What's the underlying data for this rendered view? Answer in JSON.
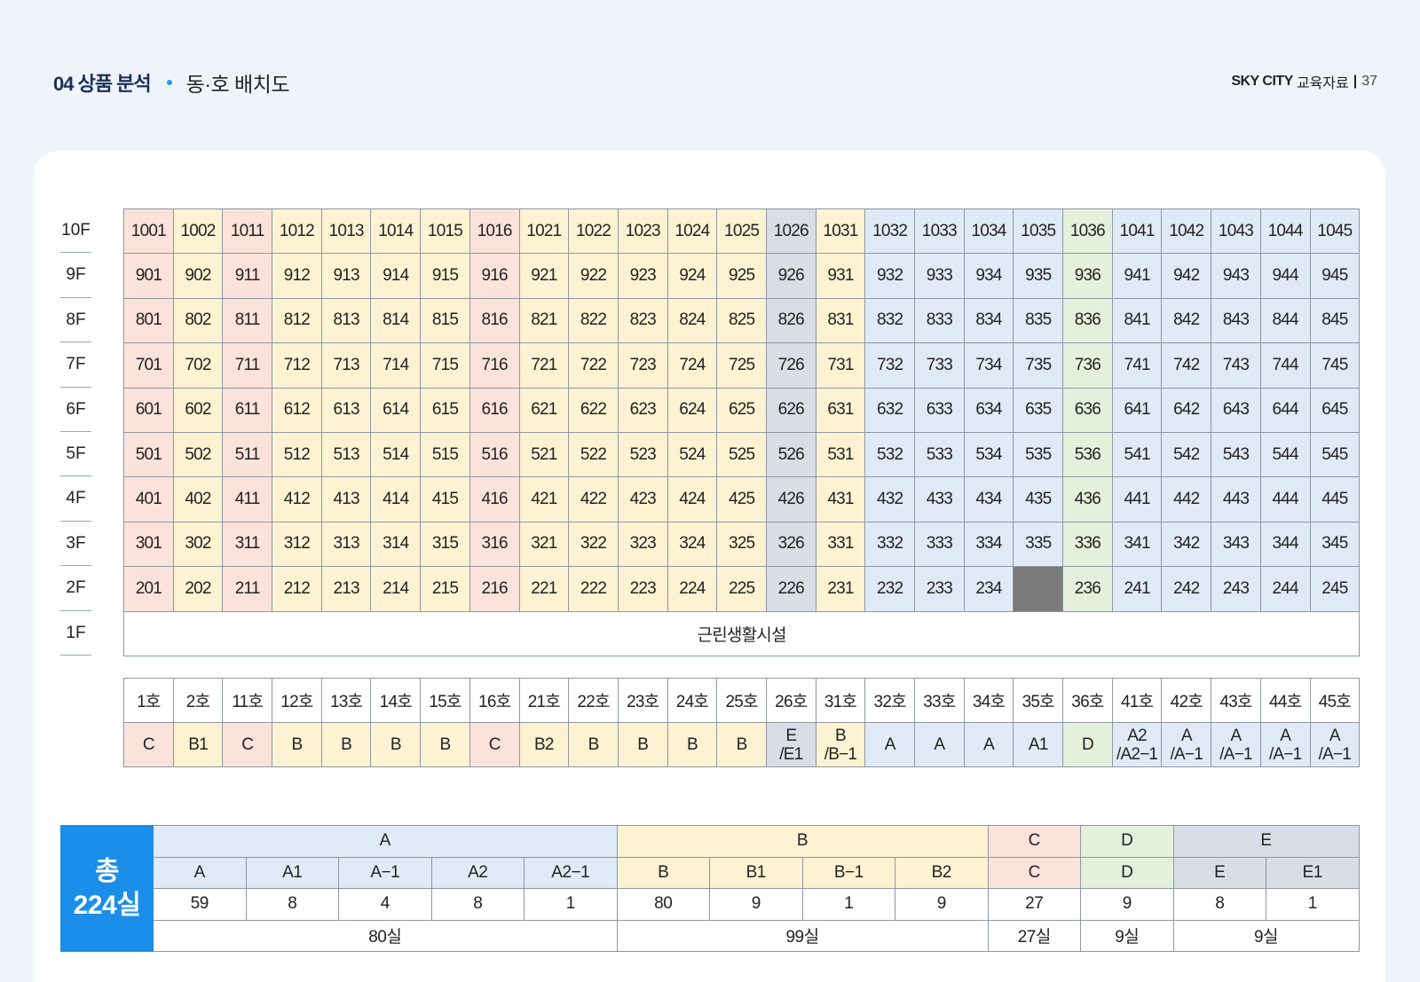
{
  "header": {
    "section": "04 상품 분석",
    "subtitle": "동·호 배치도",
    "brand": "SKY CITY",
    "doc": "교육자료",
    "page": "37"
  },
  "floors": [
    "10F",
    "9F",
    "8F",
    "7F",
    "6F",
    "5F",
    "4F",
    "3F",
    "2F",
    "1F"
  ],
  "units": [
    {
      "ho": "1호",
      "type": "C",
      "cls": "C"
    },
    {
      "ho": "2호",
      "type": "B1",
      "cls": "B"
    },
    {
      "ho": "11호",
      "type": "C",
      "cls": "C"
    },
    {
      "ho": "12호",
      "type": "B",
      "cls": "B"
    },
    {
      "ho": "13호",
      "type": "B",
      "cls": "B"
    },
    {
      "ho": "14호",
      "type": "B",
      "cls": "B"
    },
    {
      "ho": "15호",
      "type": "B",
      "cls": "B"
    },
    {
      "ho": "16호",
      "type": "C",
      "cls": "C"
    },
    {
      "ho": "21호",
      "type": "B2",
      "cls": "B"
    },
    {
      "ho": "22호",
      "type": "B",
      "cls": "B"
    },
    {
      "ho": "23호",
      "type": "B",
      "cls": "B"
    },
    {
      "ho": "24호",
      "type": "B",
      "cls": "B"
    },
    {
      "ho": "25호",
      "type": "B",
      "cls": "B"
    },
    {
      "ho": "26호",
      "type": "E\n/E1",
      "cls": "E"
    },
    {
      "ho": "31호",
      "type": "B\n/B−1",
      "cls": "B"
    },
    {
      "ho": "32호",
      "type": "A",
      "cls": "A"
    },
    {
      "ho": "33호",
      "type": "A",
      "cls": "A"
    },
    {
      "ho": "34호",
      "type": "A",
      "cls": "A"
    },
    {
      "ho": "35호",
      "type": "A1",
      "cls": "A"
    },
    {
      "ho": "36호",
      "type": "D",
      "cls": "D"
    },
    {
      "ho": "41호",
      "type": "A2\n/A2−1",
      "cls": "A"
    },
    {
      "ho": "42호",
      "type": "A\n/A−1",
      "cls": "A"
    },
    {
      "ho": "43호",
      "type": "A\n/A−1",
      "cls": "A"
    },
    {
      "ho": "44호",
      "type": "A\n/A−1",
      "cls": "A"
    },
    {
      "ho": "45호",
      "type": "A\n/A−1",
      "cls": "A"
    }
  ],
  "unit_numbers": [
    "01",
    "02",
    "11",
    "12",
    "13",
    "14",
    "15",
    "16",
    "21",
    "22",
    "23",
    "24",
    "25",
    "26",
    "31",
    "32",
    "33",
    "34",
    "35",
    "36",
    "41",
    "42",
    "43",
    "44",
    "45"
  ],
  "upper_floors": [
    10,
    9,
    8,
    7,
    6,
    5,
    4,
    3,
    2
  ],
  "empty_cells": [
    {
      "floor": 2,
      "unit": "35"
    }
  ],
  "first_floor_label": "근린생활시설",
  "summary": {
    "total_label_1": "총",
    "total_label_2": "224실",
    "groups": [
      {
        "name": "A",
        "cls": "A",
        "types": [
          "A",
          "A1",
          "A−1",
          "A2",
          "A2−1"
        ],
        "counts": [
          "59",
          "8",
          "4",
          "8",
          "1"
        ],
        "total": "80실"
      },
      {
        "name": "B",
        "cls": "B",
        "types": [
          "B",
          "B1",
          "B−1",
          "B2"
        ],
        "counts": [
          "80",
          "9",
          "1",
          "9"
        ],
        "total": "99실"
      },
      {
        "name": "C",
        "cls": "C",
        "types": [
          "C"
        ],
        "counts": [
          "27"
        ],
        "total": "27실"
      },
      {
        "name": "D",
        "cls": "D",
        "types": [
          "D"
        ],
        "counts": [
          "9"
        ],
        "total": "9실"
      },
      {
        "name": "E",
        "cls": "E",
        "types": [
          "E",
          "E1"
        ],
        "counts": [
          "8",
          "1"
        ],
        "total": "9실"
      }
    ]
  }
}
